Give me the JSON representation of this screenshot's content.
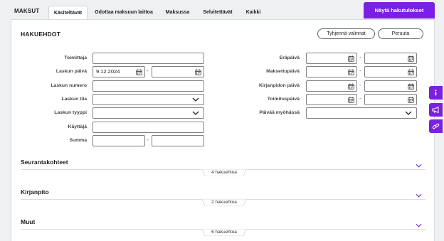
{
  "app": {
    "title": "MAKSUT"
  },
  "tabs": [
    {
      "label": "Käsiteltävät",
      "active": true
    },
    {
      "label": "Odottaa maksuun laittoa",
      "active": false
    },
    {
      "label": "Maksussa",
      "active": false
    },
    {
      "label": "Selvitettävät",
      "active": false
    },
    {
      "label": "Kaikki",
      "active": false
    }
  ],
  "show_results_label": "Näytä hakutulokset",
  "filters": {
    "title": "HAKUEHDOT",
    "clear_label": "Tyhjennä valinnat",
    "cancel_label": "Peruuta",
    "left": {
      "supplier": {
        "label": "Toimittaja",
        "value": ""
      },
      "invoice_date": {
        "label": "Laskun päivä",
        "from": "9.12.2024",
        "to": ""
      },
      "invoice_number": {
        "label": "Laskun numero",
        "value": ""
      },
      "invoice_status": {
        "label": "Laskun tila",
        "value": ""
      },
      "invoice_type": {
        "label": "Laskun tyyppi",
        "value": ""
      },
      "user": {
        "label": "Käyttäjä",
        "value": ""
      },
      "amount": {
        "label": "Summa",
        "from": "",
        "to": ""
      }
    },
    "right": {
      "due_date": {
        "label": "Eräpäivä",
        "from": "",
        "to": ""
      },
      "paid_date": {
        "label": "Maksettupäivä",
        "from": "",
        "to": ""
      },
      "booking_date": {
        "label": "Kirjanpidon päivä",
        "from": "",
        "to": ""
      },
      "delivery_date": {
        "label": "Toimituspäivä",
        "from": "",
        "to": ""
      },
      "late_days": {
        "label": "Päivää myöhässä",
        "value": ""
      }
    },
    "range_separator": "-"
  },
  "sections": [
    {
      "title": "Seurantakohteet",
      "count_label": "4 hakuehtoa"
    },
    {
      "title": "Kirjanpito",
      "count_label": "2 hakuehtoa"
    },
    {
      "title": "Muut",
      "count_label": "6 hakuehtoa"
    }
  ],
  "side_buttons": [
    "info-icon",
    "megaphone-icon",
    "link-icon"
  ],
  "colors": {
    "accent": "#7b1fe0",
    "background": "#eef0f2",
    "panel": "#ffffff"
  }
}
